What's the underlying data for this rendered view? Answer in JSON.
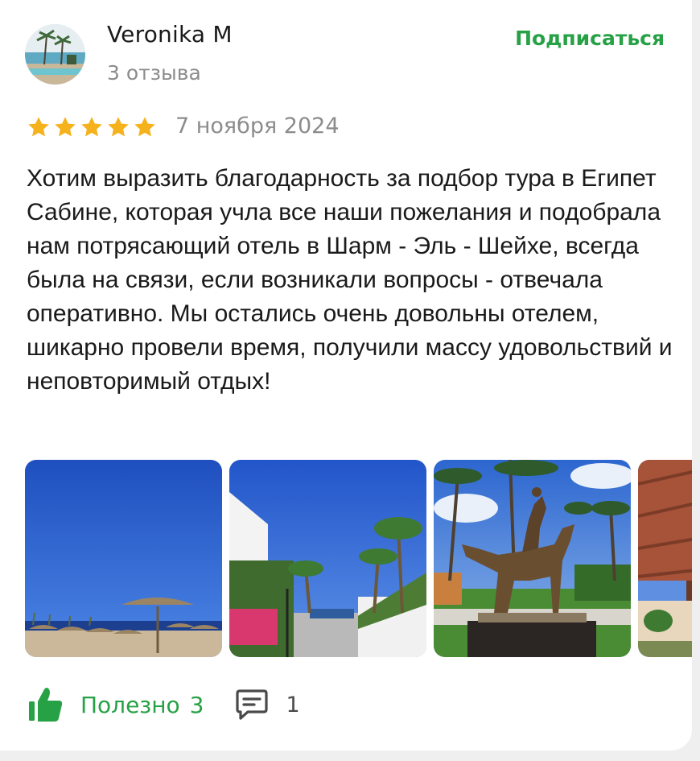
{
  "author": {
    "name": "Veronika M",
    "reviews_count": "3 отзыва",
    "subscribe_label": "Подписаться"
  },
  "rating": {
    "value": 5,
    "max": 5,
    "date": "7 ноября 2024"
  },
  "review": {
    "text": "Хотим выразить благодарность за подбор тура в Египет Сабине, которая учла все наши пожелания и подобрала нам потрясающий отель в Шарм - Эль - Шейхе, всегда была на связи, если возникали вопросы - отвечала оперативно. Мы остались очень довольны отелем, шикарно провели время, получили массу удовольствий и неповторимый отдых!"
  },
  "photos": [
    {
      "icon": "beach-umbrellas-photo"
    },
    {
      "icon": "hotel-palms-photo"
    },
    {
      "icon": "horse-statue-photo"
    },
    {
      "icon": "pergola-photo"
    }
  ],
  "actions": {
    "helpful_label": "Полезно",
    "helpful_count": "3",
    "comments_count": "1"
  },
  "colors": {
    "accent_green": "#27a146",
    "star_yellow": "#f5b21c",
    "muted_text": "#8c8c8c"
  }
}
